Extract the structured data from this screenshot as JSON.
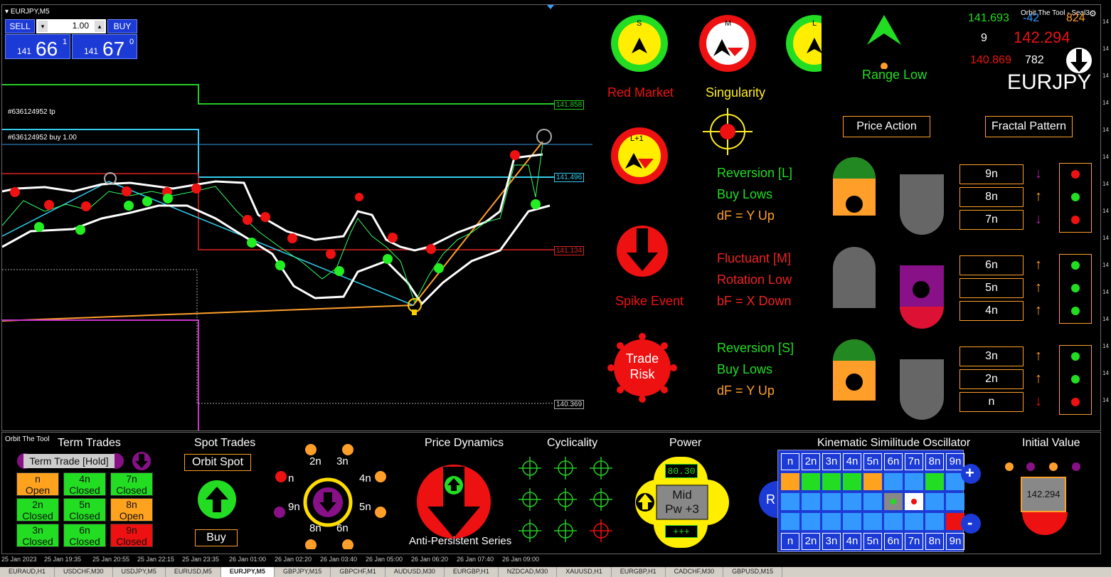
{
  "symbol_header": "EURJPY,M5",
  "trade_panel": {
    "sell_label": "SELL",
    "buy_label": "BUY",
    "lot": "1.00",
    "bid_prefix": "141",
    "bid_big": "66",
    "bid_sup": "1",
    "ask_prefix": "141",
    "ask_big": "67",
    "ask_sup": "0"
  },
  "chart_labels": {
    "tp_label": "#636124952 tp",
    "buy_label": "#636124952 buy 1.00",
    "price_green": "141.858",
    "price_cyan": "141.496",
    "price_red": "141.134",
    "price_white": "140.369"
  },
  "indicator_header": {
    "title": "Orbit The Tool - Seal3",
    "v1": "141.693",
    "v2": "-42",
    "v3": "824",
    "v4": "9",
    "v5": "142.294",
    "v6": "140.869",
    "v7": "782",
    "symbol": "EURJPY"
  },
  "markets": {
    "s_label": "S",
    "m_label": "M",
    "l_label": "L",
    "l1_label": "L+1",
    "red_market": "Red Market",
    "singularity": "Singularity",
    "range_low": "Range Low",
    "spike_event": "Spike Event",
    "trade_risk_1": "Trade",
    "trade_risk_2": "Risk"
  },
  "buttons": {
    "price_action": "Price Action",
    "fractal_pattern": "Fractal Pattern"
  },
  "states": [
    {
      "l1": "Reversion [L]",
      "l2": "Buy Lows",
      "l3": "dF = Y Up",
      "c1": "#22dd22",
      "c2": "#22dd22",
      "c3": "#ff9f2a"
    },
    {
      "l1": "Fluctuant [M]",
      "l2": "Rotation Low",
      "l3": "bF = X Down",
      "c1": "#ee2222",
      "c2": "#ee2222",
      "c3": "#ee2222"
    },
    {
      "l1": "Reversion [S]",
      "l2": "Buy Lows",
      "l3": "dF = Y Up",
      "c1": "#22dd22",
      "c2": "#22dd22",
      "c3": "#ff9f2a"
    }
  ],
  "fractals": [
    {
      "label": "9n",
      "arrow": "down",
      "dot": "red"
    },
    {
      "label": "8n",
      "arrow": "up",
      "dot": "green"
    },
    {
      "label": "7n",
      "arrow": "down",
      "dot": "red"
    },
    {
      "label": "6n",
      "arrow": "up",
      "dot": "green"
    },
    {
      "label": "5n",
      "arrow": "up",
      "dot": "green"
    },
    {
      "label": "4n",
      "arrow": "up",
      "dot": "green"
    },
    {
      "label": "3n",
      "arrow": "up",
      "dot": "green"
    },
    {
      "label": "2n",
      "arrow": "up",
      "dot": "green"
    },
    {
      "label": "n",
      "arrow": "down-red",
      "dot": "red"
    }
  ],
  "bottom": {
    "tool_name": "Orbit The Tool",
    "term_trades": "Term Trades",
    "term_trade_hold": "Term Trade [Hold]",
    "spot_trades": "Spot Trades",
    "orbit_spot": "Orbit Spot",
    "buy": "Buy",
    "price_dynamics": "Price Dynamics",
    "anti_persistent": "Anti-Persistent Series",
    "cyclicality": "Cyclicality",
    "power": "Power",
    "power_value": "80.30",
    "mid": "Mid",
    "pw": "Pw +3",
    "plus_bar": "+++",
    "kso": "Kinematic Similitude Oscillator",
    "initial_value": "Initial Value",
    "initial_price": "142.294",
    "r_label": "R",
    "plus": "+",
    "minus": "-"
  },
  "term_grid": [
    {
      "n": "n",
      "s": "Open",
      "color": "#ffa21e"
    },
    {
      "n": "4n",
      "s": "Closed",
      "color": "#22dd22"
    },
    {
      "n": "7n",
      "s": "Closed",
      "color": "#22dd22"
    },
    {
      "n": "2n",
      "s": "Closed",
      "color": "#22dd22"
    },
    {
      "n": "5n",
      "s": "Closed",
      "color": "#22dd22"
    },
    {
      "n": "8n",
      "s": "Open",
      "color": "#ffa21e"
    },
    {
      "n": "3n",
      "s": "Closed",
      "color": "#22dd22"
    },
    {
      "n": "6n",
      "s": "Closed",
      "color": "#22dd22"
    },
    {
      "n": "9n",
      "s": "Closed",
      "color": "#ee1111"
    }
  ],
  "orbit_labels": [
    "n",
    "2n",
    "3n",
    "4n",
    "5n",
    "6n",
    "8n",
    "9n"
  ],
  "kso_header": [
    "n",
    "2n",
    "3n",
    "4n",
    "5n",
    "6n",
    "7n",
    "8n",
    "9n"
  ],
  "time_axis": [
    "25 Jan 2023",
    "25 Jan 19:35",
    "25 Jan 20:55",
    "25 Jan 22:15",
    "25 Jan 23:35",
    "26 Jan 01:00",
    "26 Jan 02:20",
    "26 Jan 03:40",
    "26 Jan 05:00",
    "26 Jan 06:20",
    "26 Jan 07:40",
    "26 Jan 09:00"
  ],
  "tabs": [
    "EURAUD,H1",
    "USDCHF,M30",
    "USDJPY,M5",
    "EURUSD,M5",
    "EURJPY,M5",
    "GBPJPY,M15",
    "GBPCHF,M1",
    "AUDUSD,M30",
    "EURGBP,H1",
    "NZDCAD,M30",
    "XAUUSD,H1",
    "EURGBP,H1",
    "CADCHF,M30",
    "GBPUSD,M15"
  ],
  "active_tab": "EURJPY,M5",
  "price_scale": [
    "14",
    "14",
    "14",
    "14",
    "14",
    "14",
    "14",
    "14",
    "14",
    "14",
    "14",
    "14",
    "14",
    "14",
    "14"
  ]
}
